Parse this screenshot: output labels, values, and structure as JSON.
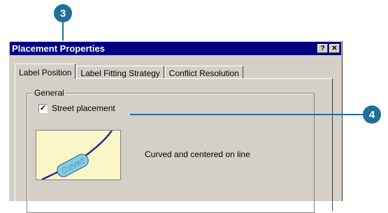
{
  "callouts": {
    "top": "3",
    "right": "4"
  },
  "window": {
    "title": "Placement Properties",
    "help_button": "?",
    "close_button": "✕"
  },
  "tabs": [
    {
      "label": "Label Position"
    },
    {
      "label": "Label Fitting Strategy"
    },
    {
      "label": "Conflict Resolution"
    }
  ],
  "group": {
    "legend": "General",
    "checkbox_label": "Street placement",
    "checkbox_checked": true,
    "checkbox_mark": "✓",
    "preview_text": "Curved",
    "description": "Curved and centered on line"
  },
  "colors": {
    "callout": "#1e6f99",
    "titlebar": "#000080",
    "preview_bg": "#fbf6c8"
  }
}
